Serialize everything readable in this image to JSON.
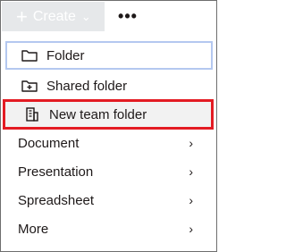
{
  "toolbar": {
    "create_label": "Create",
    "create_plus": "+",
    "create_chevron": "⌄",
    "more_label": "•••"
  },
  "menu": {
    "items": [
      {
        "label": "Folder",
        "icon": "folder-icon"
      },
      {
        "label": "Shared folder",
        "icon": "shared-folder-icon"
      },
      {
        "label": "New team folder",
        "icon": "team-folder-icon"
      },
      {
        "label": "Document",
        "has_submenu": true
      },
      {
        "label": "Presentation",
        "has_submenu": true
      },
      {
        "label": "Spreadsheet",
        "has_submenu": true
      },
      {
        "label": "More",
        "has_submenu": true
      }
    ],
    "submenu_arrow": "›"
  },
  "colors": {
    "highlight_border": "#e31b23",
    "focus_border": "#b4c8f0",
    "text": "#1e1919",
    "create_button_bg": "#e6e8ea"
  }
}
